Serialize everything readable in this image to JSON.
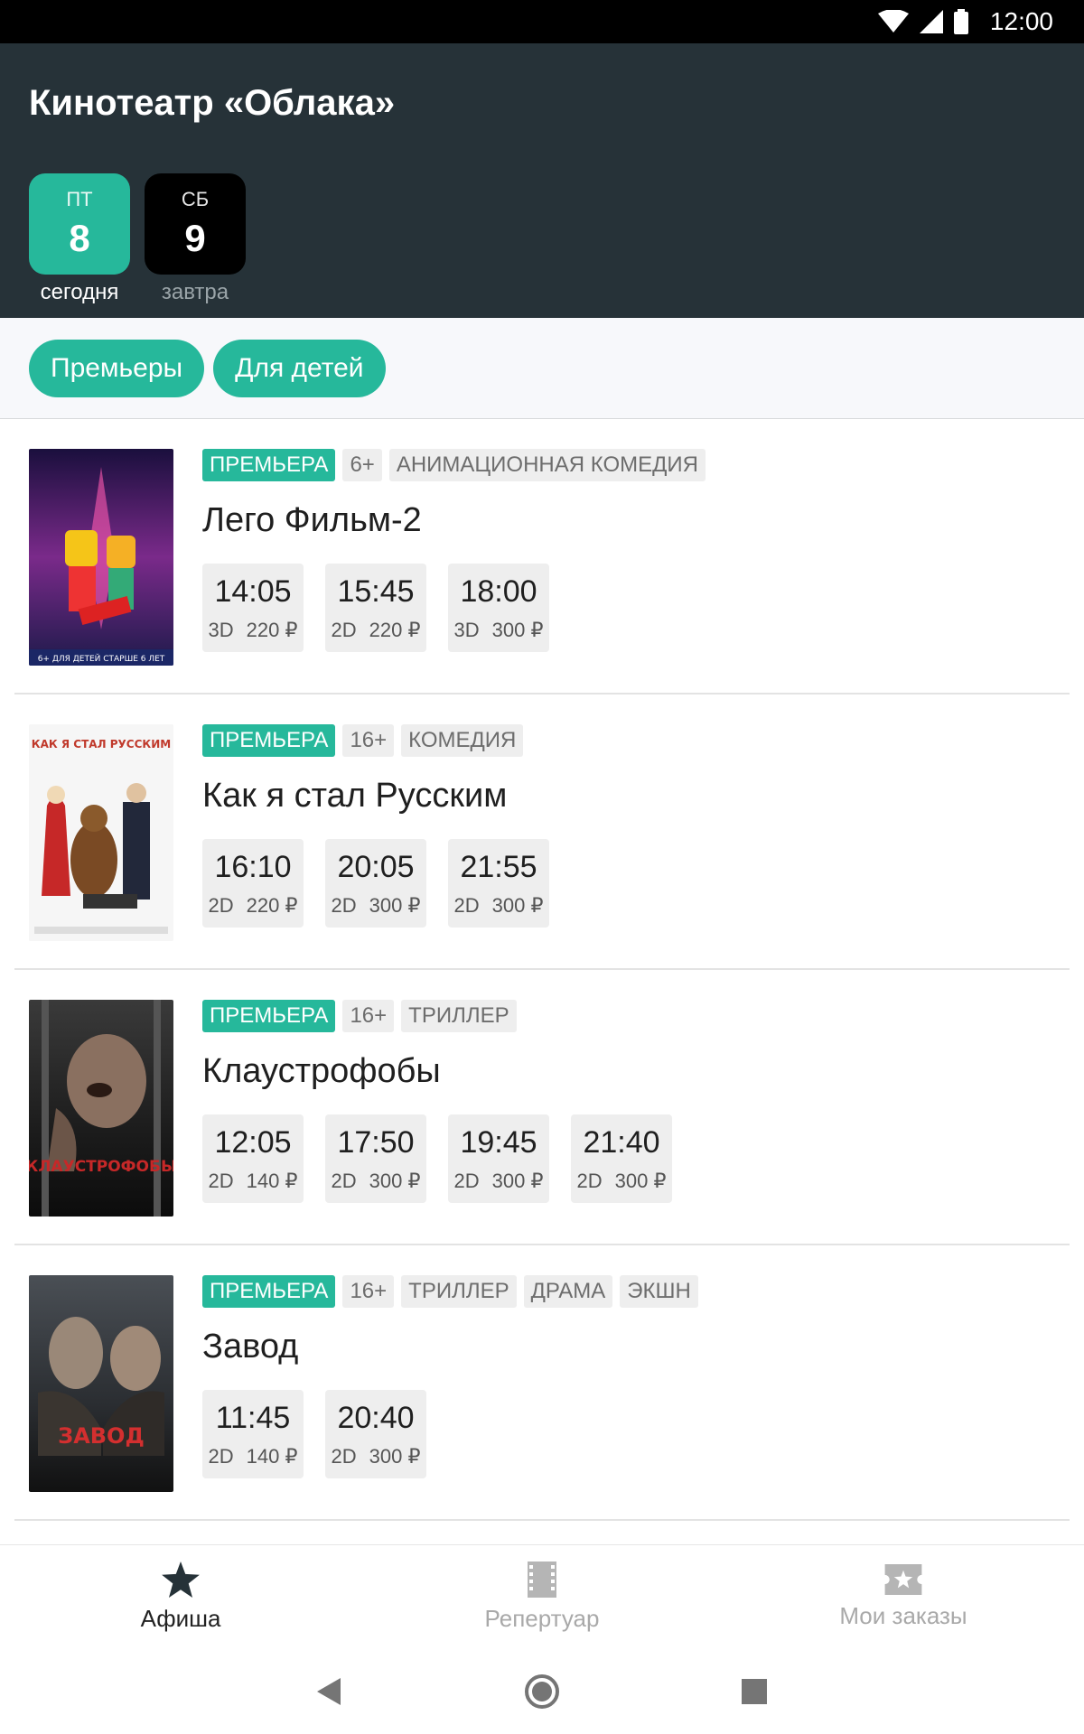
{
  "status_bar": {
    "time": "12:00",
    "icons": [
      "wifi-icon",
      "signal-icon",
      "battery-icon"
    ]
  },
  "header": {
    "title": "Кинотеатр «Облака»",
    "dates": [
      {
        "dow": "ПТ",
        "day": "8",
        "label": "сегодня"
      },
      {
        "dow": "СБ",
        "day": "9",
        "label": "завтра"
      }
    ]
  },
  "filters": [
    "Премьеры",
    "Для детей"
  ],
  "movies": [
    {
      "title": "Лего Фильм-2",
      "badge": "ПРЕМЬЕРА",
      "rating": "6+",
      "genres": [
        "АНИМАЦИОННАЯ КОМЕДИЯ"
      ],
      "poster_text": "6+ ДЛЯ ДЕТЕЙ СТАРШЕ 6 ЛЕТ",
      "sessions": [
        {
          "time": "14:05",
          "format": "3D",
          "price": "220 ₽"
        },
        {
          "time": "15:45",
          "format": "2D",
          "price": "220 ₽"
        },
        {
          "time": "18:00",
          "format": "3D",
          "price": "300 ₽"
        }
      ]
    },
    {
      "title": "Как я стал Русским",
      "badge": "ПРЕМЬЕРА",
      "rating": "16+",
      "genres": [
        "КОМЕДИЯ"
      ],
      "poster_text": "КАК Я СТАЛ РУССКИМ",
      "sessions": [
        {
          "time": "16:10",
          "format": "2D",
          "price": "220 ₽"
        },
        {
          "time": "20:05",
          "format": "2D",
          "price": "300 ₽"
        },
        {
          "time": "21:55",
          "format": "2D",
          "price": "300 ₽"
        }
      ]
    },
    {
      "title": "Клаустрофобы",
      "badge": "ПРЕМЬЕРА",
      "rating": "16+",
      "genres": [
        "ТРИЛЛЕР"
      ],
      "poster_text": "КЛАУСТРОФОБЫ",
      "sessions": [
        {
          "time": "12:05",
          "format": "2D",
          "price": "140 ₽"
        },
        {
          "time": "17:50",
          "format": "2D",
          "price": "300 ₽"
        },
        {
          "time": "19:45",
          "format": "2D",
          "price": "300 ₽"
        },
        {
          "time": "21:40",
          "format": "2D",
          "price": "300 ₽"
        }
      ]
    },
    {
      "title": "Завод",
      "badge": "ПРЕМЬЕРА",
      "rating": "16+",
      "genres": [
        "ТРИЛЛЕР",
        "ДРАМА",
        "ЭКШН"
      ],
      "poster_text": "ЗАВОД",
      "sessions": [
        {
          "time": "11:45",
          "format": "2D",
          "price": "140 ₽"
        },
        {
          "time": "20:40",
          "format": "2D",
          "price": "300 ₽"
        }
      ]
    }
  ],
  "bottom_nav": [
    {
      "label": "Афиша",
      "icon": "star-icon",
      "active": true
    },
    {
      "label": "Репертуар",
      "icon": "film-icon",
      "active": false
    },
    {
      "label": "Мои заказы",
      "icon": "ticket-icon",
      "active": false
    }
  ],
  "colors": {
    "accent": "#26b89b",
    "header_bg": "#263238",
    "tag_bg": "#eeeeee"
  }
}
